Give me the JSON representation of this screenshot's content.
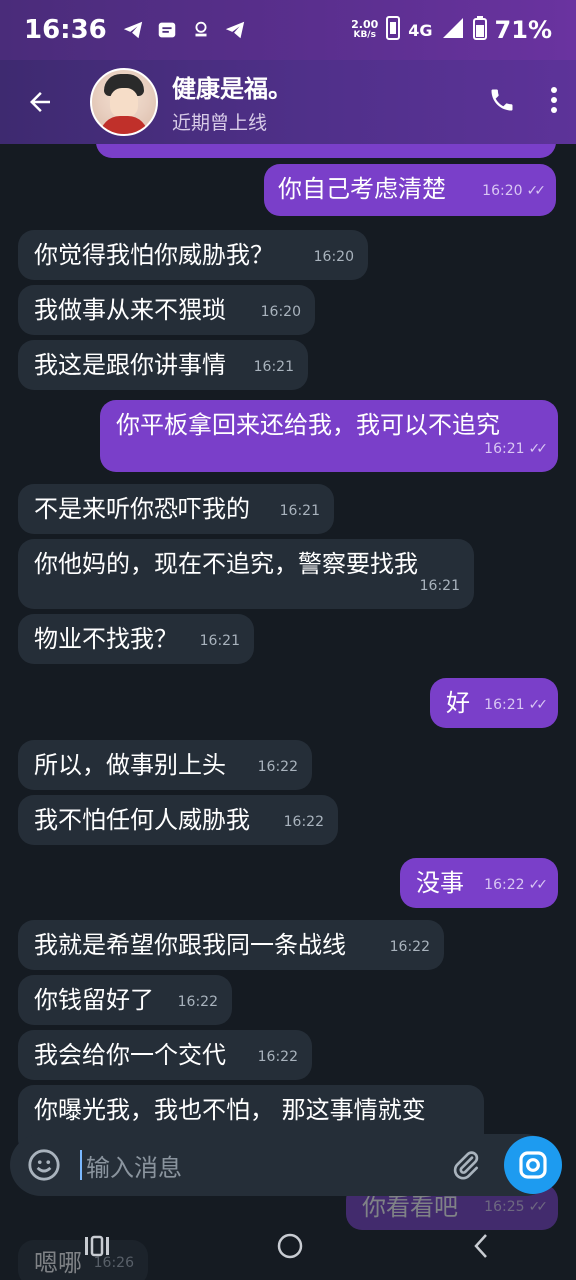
{
  "status_bar": {
    "time": "16:36",
    "net_speed": "2.00",
    "net_speed_unit": "KB/s",
    "network": "4G",
    "battery": "71%"
  },
  "header": {
    "title": "健康是福。",
    "subtitle": "近期曾上线"
  },
  "messages": [
    {
      "dir": "out",
      "text": "你自己考虑清楚",
      "time": "16:20"
    },
    {
      "dir": "in",
      "text": "你觉得我怕你威胁我？",
      "time": "16:20"
    },
    {
      "dir": "in",
      "text": "我做事从来不猥琐",
      "time": "16:20"
    },
    {
      "dir": "in",
      "text": "我这是跟你讲事情",
      "time": "16:21"
    },
    {
      "dir": "out",
      "text": "你平板拿回来还给我，我可以不追究",
      "time": "16:21"
    },
    {
      "dir": "in",
      "text": "不是来听你恐吓我的",
      "time": "16:21"
    },
    {
      "dir": "in",
      "text": "你他妈的，现在不追究，警察要找我",
      "time": "16:21"
    },
    {
      "dir": "in",
      "text": "物业不找我？",
      "time": "16:21"
    },
    {
      "dir": "out",
      "text": "好",
      "time": "16:21"
    },
    {
      "dir": "in",
      "text": "所以，做事别上头",
      "time": "16:22"
    },
    {
      "dir": "in",
      "text": "我不怕任何人威胁我",
      "time": "16:22"
    },
    {
      "dir": "out",
      "text": "没事",
      "time": "16:22"
    },
    {
      "dir": "in",
      "text": "我就是希望你跟我同一条战线",
      "time": "16:22"
    },
    {
      "dir": "in",
      "text": "你钱留好了",
      "time": "16:22"
    },
    {
      "dir": "in",
      "text": "我会给你一个交代",
      "time": "16:22"
    },
    {
      "dir": "in",
      "text": "你曝光我，我也不怕， 那这事情就变",
      "time": ""
    },
    {
      "dir": "out",
      "text": "你看看吧",
      "time": "16:25"
    },
    {
      "dir": "in",
      "text": "嗯哪",
      "time": "16:26"
    }
  ],
  "input": {
    "placeholder": "输入消息"
  },
  "colors": {
    "header_purple": "#50308a",
    "outgoing_bubble": "#7a3fc9",
    "incoming_bubble": "#252e38",
    "camera_button": "#1d9bf0",
    "background": "#151b22"
  }
}
